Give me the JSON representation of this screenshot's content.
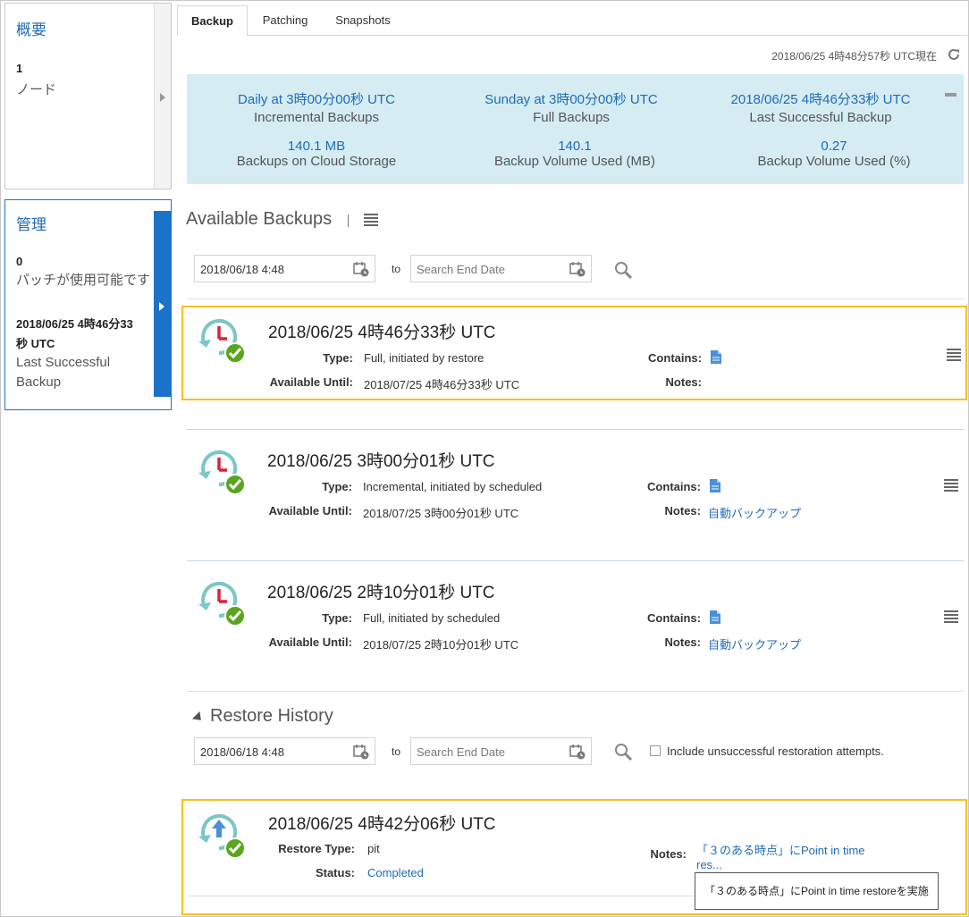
{
  "left": {
    "overview": {
      "title": "概要",
      "count": "1",
      "label": "ノード"
    },
    "management": {
      "title": "管理",
      "count": "0",
      "label": "パッチが使用可能です",
      "last_backup_line1": "2018/06/25 4時46分33",
      "last_backup_line2": "秒 UTC",
      "last_backup_label_line1": "Last Successful",
      "last_backup_label_line2": "Backup"
    }
  },
  "tabs": [
    {
      "label": "Backup",
      "active": true
    },
    {
      "label": "Patching",
      "active": false
    },
    {
      "label": "Snapshots",
      "active": false
    }
  ],
  "as_of": "2018/06/25 4時48分57秒 UTC現在",
  "summary": {
    "daily_value": "Daily at 3時00分00秒 UTC",
    "daily_label": "Incremental Backups",
    "weekly_value": "Sunday at 3時00分00秒 UTC",
    "weekly_label": "Full Backups",
    "last_value": "2018/06/25 4時46分33秒 UTC",
    "last_label": "Last Successful Backup",
    "storage_value": "140.1 MB",
    "storage_label": "Backups on Cloud Storage",
    "volume_mb_value": "140.1",
    "volume_mb_label": "Backup Volume Used (MB)",
    "volume_pct_value": "0.27",
    "volume_pct_label": "Backup Volume Used (%)"
  },
  "available_backups": {
    "title": "Available Backups",
    "start_date": "2018/06/18 4:48",
    "end_placeholder": "Search End Date",
    "to_label": "to",
    "labels": {
      "type": "Type:",
      "available_until": "Available Until:",
      "contains": "Contains:",
      "notes": "Notes:"
    },
    "items": [
      {
        "timestamp": "2018/06/25 4時46分33秒 UTC",
        "type": "Full, initiated by restore",
        "available_until": "2018/07/25 4時46分33秒 UTC",
        "notes": ""
      },
      {
        "timestamp": "2018/06/25 3時00分01秒 UTC",
        "type": "Incremental, initiated by scheduled",
        "available_until": "2018/07/25 3時00分01秒 UTC",
        "notes": "自動バックアップ"
      },
      {
        "timestamp": "2018/06/25 2時10分01秒 UTC",
        "type": "Full, initiated by scheduled",
        "available_until": "2018/07/25 2時10分01秒 UTC",
        "notes": "自動バックアップ"
      }
    ]
  },
  "restore_history": {
    "title": "Restore History",
    "start_date": "2018/06/18 4:48",
    "end_placeholder": "Search End Date",
    "to_label": "to",
    "include_unsuccessful": "Include unsuccessful restoration attempts.",
    "labels": {
      "restore_type": "Restore Type:",
      "status": "Status:",
      "notes": "Notes:"
    },
    "items": [
      {
        "timestamp": "2018/06/25 4時42分06秒 UTC",
        "restore_type": "pit",
        "status": "Completed",
        "notes_line1": "「３のある時点」にPoint in time",
        "notes_line2": "res...",
        "tooltip": "「３のある時点」にPoint in time restoreを実施"
      }
    ]
  },
  "colors": {
    "accent": "#1e6bb8",
    "highlight": "#f5c020",
    "summary_bg": "#d4ecf2",
    "success": "#5aa51e",
    "panel_active": "#1a73c9"
  }
}
